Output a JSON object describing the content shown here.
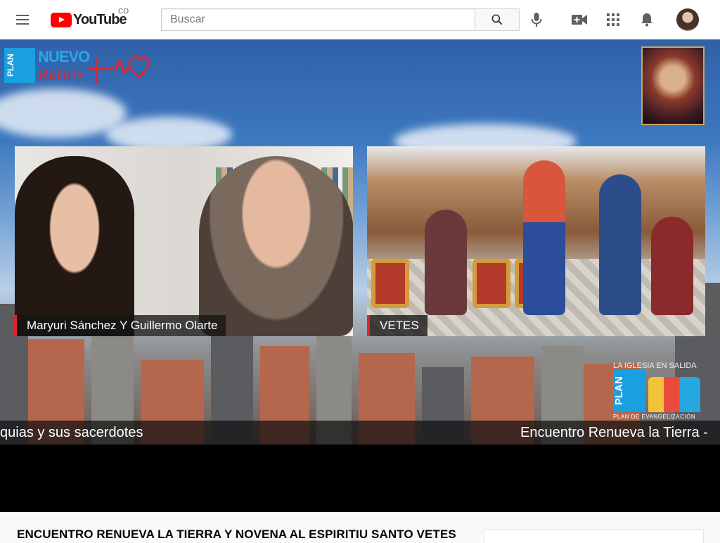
{
  "masthead": {
    "logo_text": "YouTube",
    "country_code": "CO",
    "search_placeholder": "Buscar",
    "icons": [
      "menu-icon",
      "search-icon",
      "microphone-icon",
      "create-video-icon",
      "apps-icon",
      "notifications-icon",
      "avatar"
    ]
  },
  "video": {
    "brand_logo": {
      "plan": "PLAN",
      "nuevo": "NUEVO",
      "retiro": "Retiro"
    },
    "panels": [
      {
        "caption": "Maryuri Sánchez Y Guillermo Olarte"
      },
      {
        "caption": "VETES"
      }
    ],
    "corner_logo": {
      "top": "LA IGLESIA EN SALIDA",
      "plan": "PLAN",
      "bottom": "PLAN DE EVANGELIZACIÓN"
    },
    "ticker": [
      "quias y sus sacerdotes",
      "Encuentro Renueva la Tierra -"
    ],
    "accent": "#e0242b"
  },
  "watch": {
    "title": "ENCUENTRO RENUEVA LA TIERRA Y NOVENA AL ESPIRITIU SANTO VETES"
  }
}
